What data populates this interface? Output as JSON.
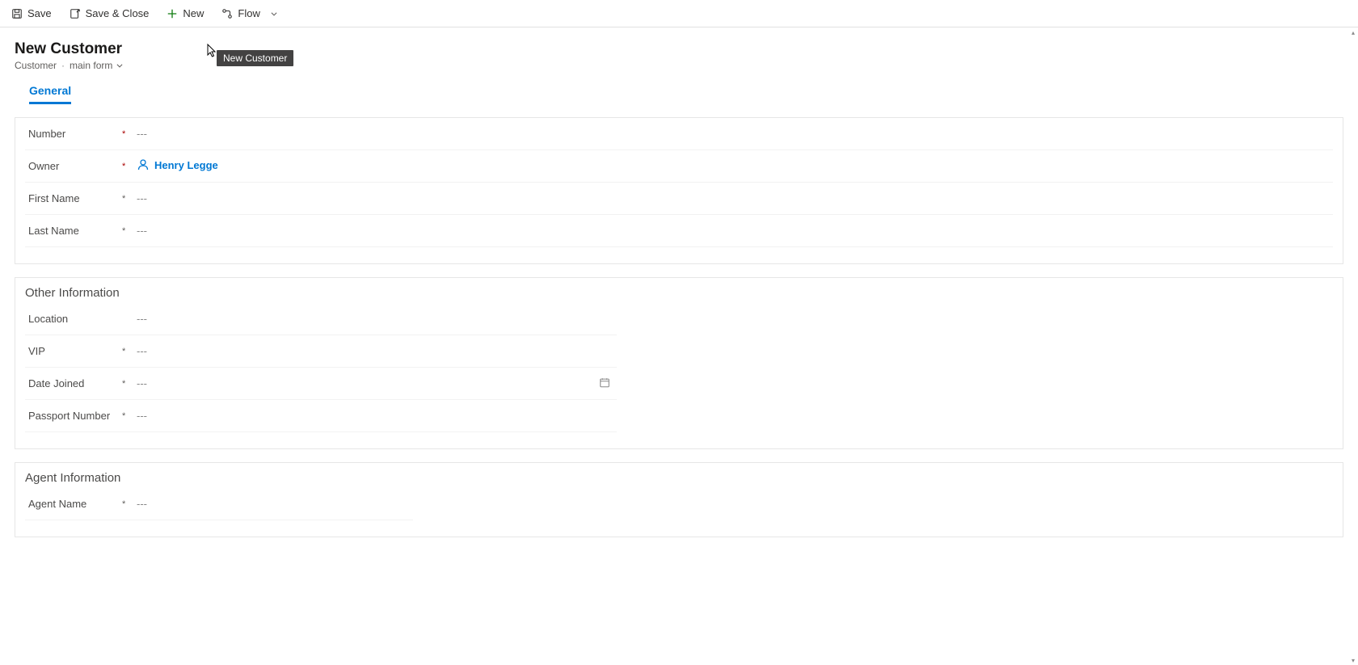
{
  "commandBar": {
    "save": "Save",
    "saveClose": "Save & Close",
    "new": "New",
    "flow": "Flow"
  },
  "header": {
    "title": "New Customer",
    "entity": "Customer",
    "formName": "main form",
    "tooltip": "New Customer"
  },
  "tabs": {
    "general": "General"
  },
  "fields": {
    "number": {
      "label": "Number",
      "value": "---"
    },
    "owner": {
      "label": "Owner",
      "value": "Henry Legge"
    },
    "firstName": {
      "label": "First Name",
      "value": "---"
    },
    "lastName": {
      "label": "Last Name",
      "value": "---"
    }
  },
  "otherInfo": {
    "title": "Other Information",
    "location": {
      "label": "Location",
      "value": "---"
    },
    "vip": {
      "label": "VIP",
      "value": "---"
    },
    "dateJoined": {
      "label": "Date Joined",
      "value": "---"
    },
    "passport": {
      "label": "Passport Number",
      "value": "---"
    }
  },
  "agentInfo": {
    "title": "Agent Information",
    "agentName": {
      "label": "Agent Name",
      "value": "---"
    }
  }
}
